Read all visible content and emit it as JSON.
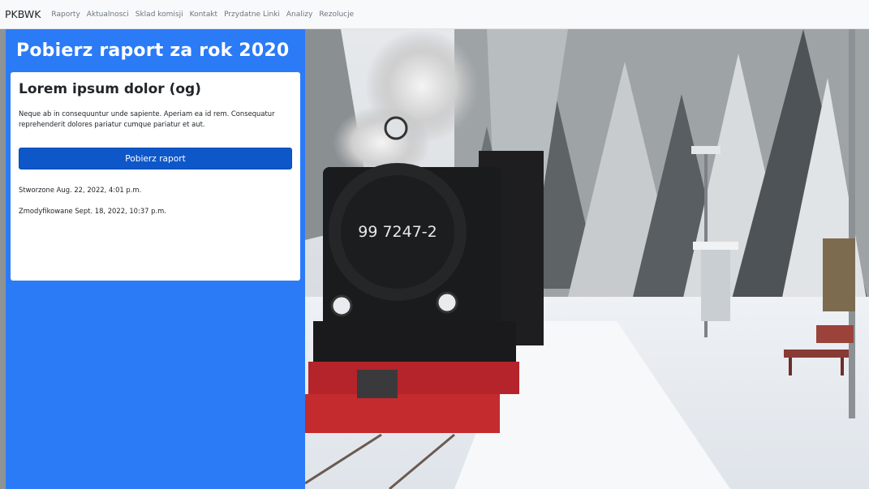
{
  "navbar": {
    "brand": "PKBWK",
    "links": [
      "Raporty",
      "Aktualnosci",
      "Sklad komisji",
      "Kontakt",
      "Przydatne Linki",
      "Analizy",
      "Rezolucje"
    ]
  },
  "panel": {
    "title": "Pobierz raport za rok 2020",
    "card": {
      "title": "Lorem ipsum dolor (og)",
      "text": "Neque ab in consequuntur unde sapiente. Aperiam ea id rem. Consequatur reprehenderit dolores pariatur cumque pariatur et aut.",
      "button_label": "Pobierz raport",
      "created": "Stworzone Aug. 22, 2022, 4:01 p.m.",
      "modified": "Zmodyfikowane Sept. 18, 2022, 10:37 p.m."
    }
  },
  "photo": {
    "locomotive_number": "99 7247-2"
  },
  "colors": {
    "panel_blue": "#2b7bf7",
    "button_blue": "#0d57c9",
    "navbar_bg": "#f8f9fa"
  }
}
